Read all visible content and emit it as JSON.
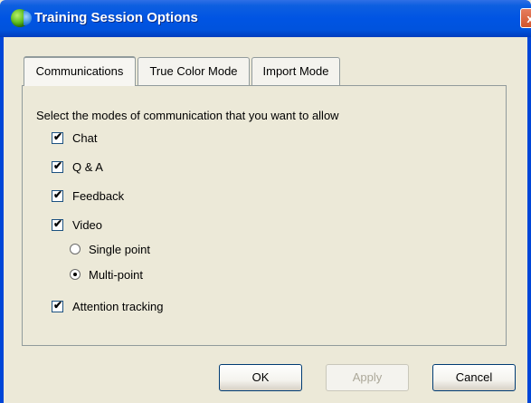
{
  "window": {
    "title": "Training Session Options",
    "close_glyph": "x"
  },
  "tabs": [
    {
      "label": "Communications",
      "selected": true
    },
    {
      "label": "True Color Mode",
      "selected": false
    },
    {
      "label": "Import Mode",
      "selected": false
    }
  ],
  "communications": {
    "header": "Select the modes of communication that you want to allow",
    "options": [
      {
        "label": "Chat",
        "checked": true
      },
      {
        "label": "Q & A",
        "checked": true
      },
      {
        "label": "Feedback",
        "checked": true
      },
      {
        "label": "Video",
        "checked": true
      },
      {
        "label": "Attention tracking",
        "checked": true
      }
    ],
    "video_modes": [
      {
        "label": "Single point",
        "selected": false
      },
      {
        "label": "Multi-point",
        "selected": true
      }
    ],
    "check_glyph": "✔"
  },
  "buttons": {
    "ok": "OK",
    "apply": "Apply",
    "cancel": "Cancel"
  }
}
